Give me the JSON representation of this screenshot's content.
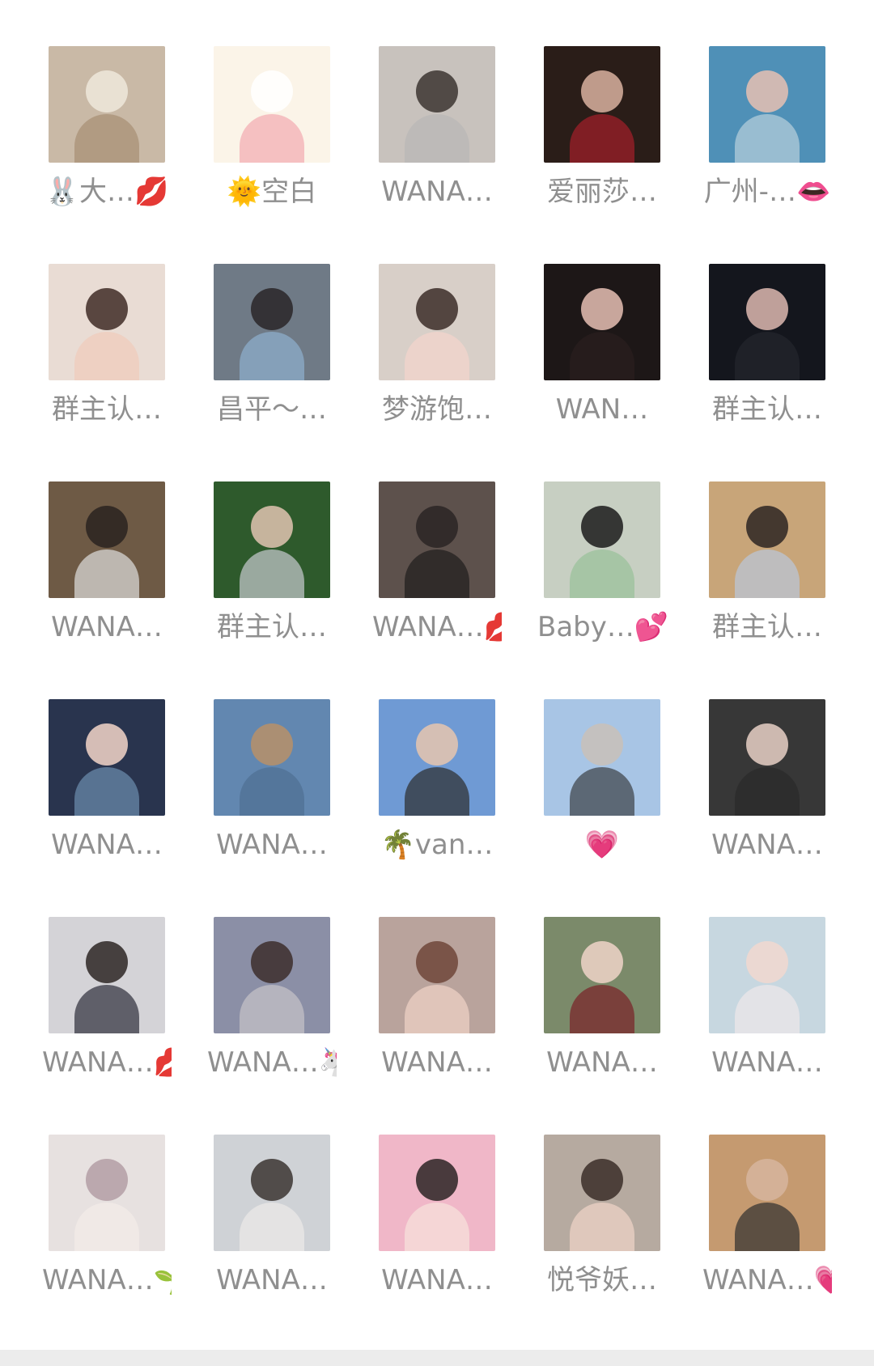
{
  "members": [
    {
      "name": "🐰大…💋",
      "photo_bg": "#c9b9a6",
      "fg": "#efe7db",
      "body": "#a78f74"
    },
    {
      "name": "🌞空白",
      "photo_bg": "#fbf4e8",
      "fg": "#ffffff",
      "body": "#f2a9b1"
    },
    {
      "name": "WANA…",
      "photo_bg": "#c8c2bd",
      "fg": "#3c3531",
      "body": "#b8b6b7"
    },
    {
      "name": "爱丽莎…",
      "photo_bg": "#2a1d18",
      "fg": "#d9b1a0",
      "body": "#a51f2a"
    },
    {
      "name": "广州-…👄",
      "photo_bg": "#4f90b7",
      "fg": "#e6c1b3",
      "body": "#b9d0dc"
    },
    {
      "name": "群主认…",
      "photo_bg": "#e9dcd4",
      "fg": "#3f2c26",
      "body": "#f0cbbb"
    },
    {
      "name": "昌平～…",
      "photo_bg": "#6f7a86",
      "fg": "#2a2628",
      "body": "#8eb0cf"
    },
    {
      "name": "梦游饱…",
      "photo_bg": "#d8cfc8",
      "fg": "#3c2d28",
      "body": "#f5d4cc"
    },
    {
      "name": "WAN…",
      "photo_bg": "#1d1717",
      "fg": "#e6c0b4",
      "body": "#2b2020"
    },
    {
      "name": "群主认…",
      "photo_bg": "#14161d",
      "fg": "#ddb8b0",
      "body": "#24262e"
    },
    {
      "name": "WANA…",
      "photo_bg": "#6e5a45",
      "fg": "#2a2320",
      "body": "#dedede"
    },
    {
      "name": "群主认…",
      "photo_bg": "#2e5a2c",
      "fg": "#e1c4b2",
      "body": "#c9cbd0"
    },
    {
      "name": "WANA…💋",
      "photo_bg": "#5d514c",
      "fg": "#2a2424",
      "body": "#1f1c1c"
    },
    {
      "name": "Baby…💕",
      "photo_bg": "#c7cfc2",
      "fg": "#1b1b1b",
      "body": "#98c199"
    },
    {
      "name": "群主认…",
      "photo_bg": "#c8a579",
      "fg": "#2d2522",
      "body": "#b9c8dc"
    },
    {
      "name": "WANA…",
      "photo_bg": "#29344e",
      "fg": "#f3d6c9",
      "body": "#6c8faf"
    },
    {
      "name": "WANA…",
      "photo_bg": "#6287b0",
      "fg": "#b99069",
      "body": "#4e6f93"
    },
    {
      "name": "🌴van…",
      "photo_bg": "#6f9ad4",
      "fg": "#e8c6ae",
      "body": "#2c2c2c"
    },
    {
      "name": "💗",
      "photo_bg": "#a8c5e5",
      "fg": "#c9c0b9",
      "body": "#3c4046"
    },
    {
      "name": "WANA…",
      "photo_bg": "#373737",
      "fg": "#e7d0c6",
      "body": "#2a2a2a"
    },
    {
      "name": "WANA…💋",
      "photo_bg": "#d4d3d7",
      "fg": "#2d2624",
      "body": "#2e2e3a"
    },
    {
      "name": "WANA…🦄",
      "photo_bg": "#8b8fa6",
      "fg": "#3c2e2c",
      "body": "#c7c3c9"
    },
    {
      "name": "WANA…",
      "photo_bg": "#b9a39c",
      "fg": "#6e4639",
      "body": "#f1d3c8"
    },
    {
      "name": "WANA…",
      "photo_bg": "#7b8a6a",
      "fg": "#f0d4c8",
      "body": "#7a2128"
    },
    {
      "name": "WANA…",
      "photo_bg": "#c7d7e0",
      "fg": "#f1d8cf",
      "body": "#efe8ea"
    },
    {
      "name": "WANA…🌱",
      "photo_bg": "#e7e1e0",
      "fg": "#b39ea5",
      "body": "#f3ede8"
    },
    {
      "name": "WANA…",
      "photo_bg": "#cfd2d6",
      "fg": "#3b3531",
      "body": "#eceae8"
    },
    {
      "name": "WANA…",
      "photo_bg": "#f0b7c8",
      "fg": "#2b2424",
      "body": "#f6e2dc"
    },
    {
      "name": "悦爷妖…",
      "photo_bg": "#b6aaa0",
      "fg": "#3b2e28",
      "body": "#f1d4c8"
    },
    {
      "name": "WANA…💗",
      "photo_bg": "#c59a70",
      "fg": "#d6b59d",
      "body": "#2f2f2f"
    }
  ]
}
